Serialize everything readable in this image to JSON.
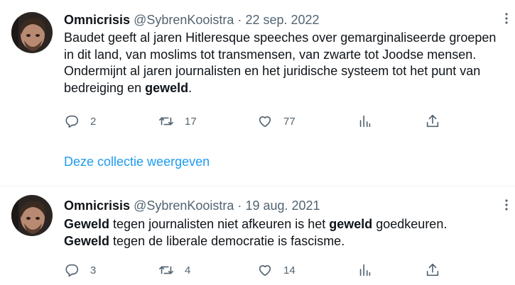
{
  "tweets": [
    {
      "author_name": "Omnicrisis",
      "handle": "@SybrenKooistra",
      "separator": "·",
      "date": "22 sep. 2022",
      "text_parts": [
        "Baudet geeft al jaren Hitleresque speeches over gemarginaliseerde groepen in dit land, van moslims tot transmensen, van zwarte tot Joodse mensen. Ondermijnt al jaren journalisten en het juridische systeem tot het punt van bedreiging en ",
        "geweld",
        "."
      ],
      "replies": "2",
      "retweets": "17",
      "likes": "77",
      "collection_link": "Deze collectie weergeven"
    },
    {
      "author_name": "Omnicrisis",
      "handle": "@SybrenKooistra",
      "separator": "·",
      "date": "19 aug. 2021",
      "text_parts": [
        "Geweld",
        " tegen journalisten niet afkeuren is het ",
        "geweld",
        " goedkeuren.",
        "Geweld",
        " tegen de liberale democratie is fascisme."
      ],
      "replies": "3",
      "retweets": "4",
      "likes": "14"
    }
  ],
  "icons": {
    "reply": "reply-icon",
    "retweet": "retweet-icon",
    "like": "heart-icon",
    "views": "analytics-icon",
    "share": "share-icon"
  },
  "colors": {
    "text": "#0f1419",
    "secondary": "#536471",
    "link": "#1d9bf0",
    "divider": "#eff3f4"
  }
}
